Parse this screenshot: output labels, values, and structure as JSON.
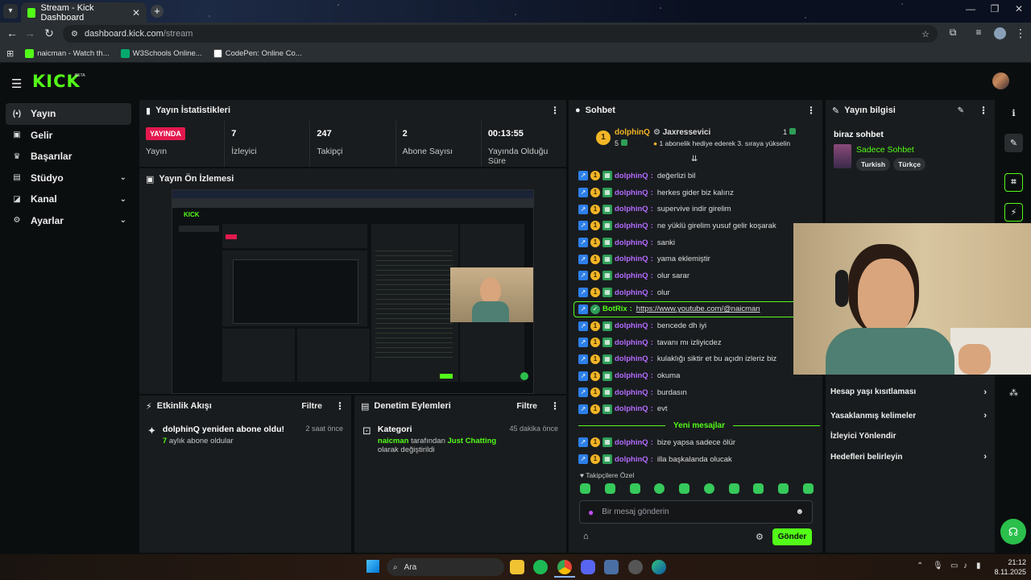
{
  "browser": {
    "tab_title": "Stream - Kick Dashboard",
    "url_host": "dashboard.kick.com",
    "url_path": "/stream",
    "bookmarks": [
      "naicman - Watch th...",
      "W3Schools Online...",
      "CodePen: Online Co..."
    ]
  },
  "app": {
    "logo": "KICK",
    "beta": "BETA"
  },
  "sidebar": {
    "items": [
      {
        "label": "Yayın",
        "icon": "broadcast-icon",
        "active": true
      },
      {
        "label": "Gelir",
        "icon": "wallet-icon"
      },
      {
        "label": "Başarılar",
        "icon": "trophy-icon"
      },
      {
        "label": "Stüdyo",
        "icon": "studio-icon",
        "expandable": true
      },
      {
        "label": "Kanal",
        "icon": "channel-icon",
        "expandable": true
      },
      {
        "label": "Ayarlar",
        "icon": "gear-icon",
        "expandable": true
      }
    ]
  },
  "stats": {
    "title": "Yayın İstatistikleri",
    "live_badge": "YAYINDA",
    "items": [
      {
        "value": "",
        "label": "Yayın"
      },
      {
        "value": "7",
        "label": "İzleyici"
      },
      {
        "value": "247",
        "label": "Takipçi"
      },
      {
        "value": "2",
        "label": "Abone Sayısı"
      },
      {
        "value": "00:13:55",
        "label": "Yayında Olduğu Süre"
      }
    ]
  },
  "preview": {
    "title": "Yayın Ön İzlemesi"
  },
  "events": {
    "title": "Etkinlik Akışı",
    "filter": "Filtre",
    "item": {
      "title": "dolphinQ yeniden abone oldu!",
      "count": "7",
      "sub": " aylık abone oldular",
      "time": "2 saat önce"
    }
  },
  "audits": {
    "title": "Denetim Eylemleri",
    "filter": "Filtre",
    "item": {
      "title": "Kategori",
      "time": "45 dakika önce",
      "actor": "naicman",
      "mid": " tarafından ",
      "category": "Just Chatting",
      "tail": " olarak değiştirildi"
    }
  },
  "chat": {
    "title": "Sohbet",
    "pinned": {
      "user": "dolphinQ",
      "badge_level": "1",
      "count": "5",
      "gifter": "Jaxressevici",
      "gift_count": "1",
      "gift_text": "1 abonelik hediye ederek 3. sıraya yükselin"
    },
    "messages": [
      {
        "user": "dolphinQ",
        "text": "değerlizi bil"
      },
      {
        "user": "dolphinQ",
        "text": "herkes gider biz kalırız"
      },
      {
        "user": "dolphinQ",
        "text": "supervive indir girelim"
      },
      {
        "user": "dolphinQ",
        "text": "ne yüklü girelim yusuf gelir koşarak"
      },
      {
        "user": "dolphinQ",
        "text": "sanki"
      },
      {
        "user": "dolphinQ",
        "text": "yama eklemiştir"
      },
      {
        "user": "dolphinQ",
        "text": "olur sarar"
      },
      {
        "user": "dolphinQ",
        "text": "olur"
      },
      {
        "user": "BotRix",
        "text": "https://www.youtube.com/@naicman",
        "bot": true
      },
      {
        "user": "dolphinQ",
        "text": "bencede dh iyi"
      },
      {
        "user": "dolphinQ",
        "text": "tavanı mı izliyicdez"
      },
      {
        "user": "dolphinQ",
        "text": "kulaklığı siktir et bu açıdn izleriz biz"
      },
      {
        "user": "dolphinQ",
        "text": "okuma"
      },
      {
        "user": "dolphinQ",
        "text": "burdasın"
      },
      {
        "user": "dolphinQ",
        "text": "evt"
      }
    ],
    "new_messages_label": "Yeni mesajlar",
    "new_messages": [
      {
        "user": "dolphinQ",
        "text": "bize yapsa sadece ölür"
      },
      {
        "user": "dolphinQ",
        "text": "illa başkalanda olucak"
      }
    ],
    "followers_only": "Takipçilere Özel",
    "input_placeholder": "Bir mesaj gönderin",
    "send_label": "Gönder"
  },
  "info": {
    "title": "Yayın bilgisi",
    "stream_title": "biraz sohbet",
    "category": "Sadece Sohbet",
    "tags": [
      "Turkish",
      "Türkçe"
    ],
    "settings": [
      {
        "label": "Hesap yaşı kısıtlaması",
        "chevron": true
      },
      {
        "label": "Yasaklanmış kelimeler",
        "chevron": true
      },
      {
        "label": "İzleyici Yönlendir",
        "chevron": false
      },
      {
        "label": "Hedefleri belirleyin",
        "chevron": true
      }
    ]
  },
  "taskbar": {
    "search": "Ara",
    "time": "21:12",
    "date": "8.11.2025"
  }
}
